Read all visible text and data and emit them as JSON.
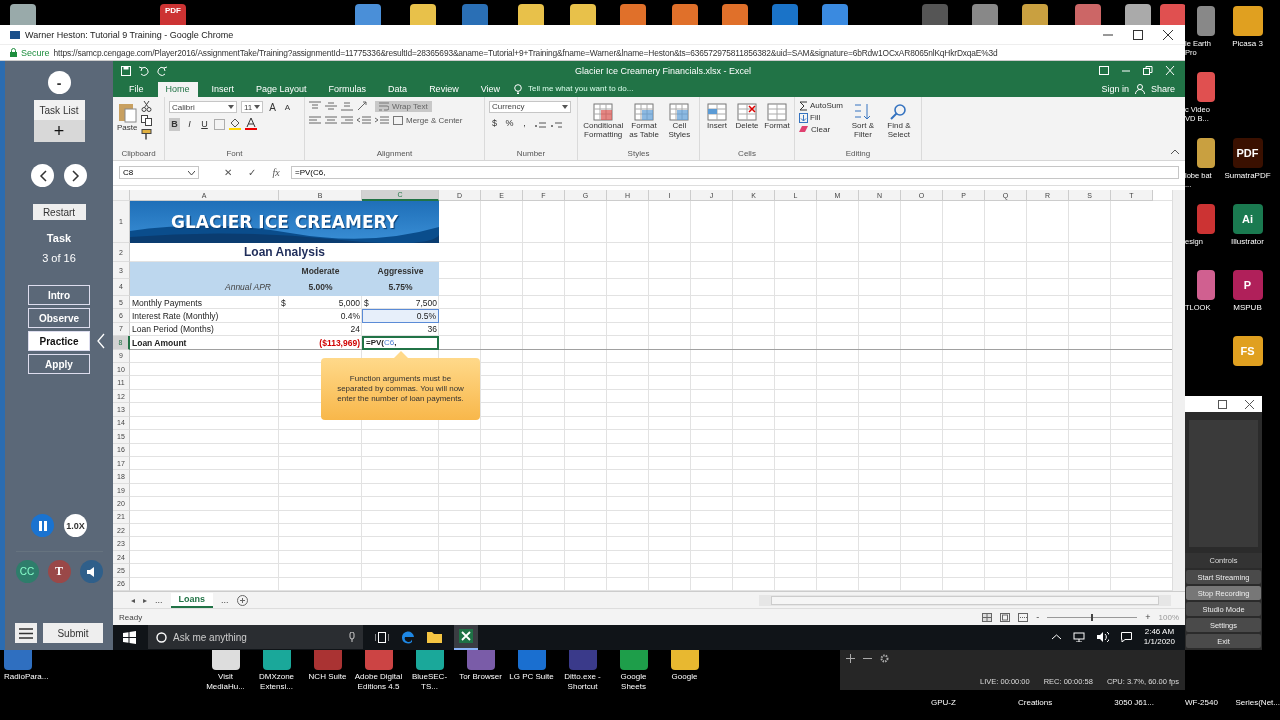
{
  "top_strip": {
    "pdf_badge": "PDF"
  },
  "browser": {
    "title": "Warner Heston: Tutorial 9 Training - Google Chrome",
    "secure": "Secure",
    "url": "https://samcp.cengage.com/Player2016/AssignmentTake/Training?assignmentId=11775336&resultId=28365693&aname=Tutorial+9+Training&fname=Warner&lname=Heston&ts=636572975811856382&uid=SAM&signature=6bRdw1OCxAR8065nlKqHkrDxqaE%3d"
  },
  "sam_panel": {
    "collapse": "-",
    "task_list": "Task List",
    "add": "+",
    "restart": "Restart",
    "task_label": "Task",
    "task_count": "3 of 16",
    "modes": [
      {
        "label": "Intro",
        "selected": false
      },
      {
        "label": "Observe",
        "selected": false
      },
      {
        "label": "Practice",
        "selected": true
      },
      {
        "label": "Apply",
        "selected": false
      }
    ],
    "speed": "1.0X",
    "captions": "CC",
    "transcript": "T",
    "submit": "Submit"
  },
  "excel": {
    "title": "Glacier Ice Creamery Financials.xlsx - Excel",
    "tabs": [
      {
        "label": "File",
        "selected": false
      },
      {
        "label": "Home",
        "selected": true
      },
      {
        "label": "Insert",
        "selected": false
      },
      {
        "label": "Page Layout",
        "selected": false
      },
      {
        "label": "Formulas",
        "selected": false
      },
      {
        "label": "Data",
        "selected": false
      },
      {
        "label": "Review",
        "selected": false
      },
      {
        "label": "View",
        "selected": false
      }
    ],
    "tell_me": "Tell me what you want to do...",
    "sign_in": "Sign in",
    "share": "Share",
    "clipboard": {
      "label": "Clipboard",
      "paste": "Paste"
    },
    "font": {
      "label": "Font",
      "family": "Calibri",
      "size": "11",
      "grow": "A",
      "shrink": "A",
      "styles": [
        {
          "label": "B",
          "selected": true
        },
        {
          "label": "I",
          "selected": false
        },
        {
          "label": "U",
          "selected": false
        }
      ]
    },
    "alignment": {
      "label": "Alignment",
      "wrap": "Wrap Text",
      "merge": "Merge & Center"
    },
    "number": {
      "label": "Number",
      "format": "Currency",
      "symbols": [
        "$",
        "%",
        ","
      ]
    },
    "styles": {
      "label": "Styles",
      "buttons": [
        "Conditional Formatting",
        "Format as Table",
        "Cell Styles"
      ]
    },
    "cells": {
      "label": "Cells",
      "buttons": [
        "Insert",
        "Delete",
        "Format"
      ]
    },
    "editing": {
      "label": "Editing",
      "autosum": "AutoSum",
      "fill": "Fill",
      "clear": "Clear",
      "buttons": [
        "Sort & Filter",
        "Find & Select"
      ]
    },
    "name_box": "C8",
    "cancel": "✕",
    "enter": "✓",
    "fx": "fx",
    "formula": "=PV(C6,",
    "columns": [
      {
        "label": "A",
        "selected": false
      },
      {
        "label": "B",
        "selected": false
      },
      {
        "label": "C",
        "selected": true
      },
      {
        "label": "D",
        "selected": false
      },
      {
        "label": "E",
        "selected": false
      },
      {
        "label": "F",
        "selected": false
      },
      {
        "label": "G",
        "selected": false
      },
      {
        "label": "H",
        "selected": false
      },
      {
        "label": "I",
        "selected": false
      },
      {
        "label": "J",
        "selected": false
      },
      {
        "label": "K",
        "selected": false
      },
      {
        "label": "L",
        "selected": false
      },
      {
        "label": "M",
        "selected": false
      },
      {
        "label": "N",
        "selected": false
      },
      {
        "label": "O",
        "selected": false
      },
      {
        "label": "P",
        "selected": false
      },
      {
        "label": "Q",
        "selected": false
      },
      {
        "label": "R",
        "selected": false
      },
      {
        "label": "S",
        "selected": false
      },
      {
        "label": "T",
        "selected": false
      }
    ],
    "rows": [
      {
        "number": "1",
        "kind": "banner",
        "selected": false,
        "text": "GLACIER ICE CREAMERY"
      },
      {
        "number": "2",
        "kind": "title",
        "selected": false,
        "text": "Loan Analysis"
      },
      {
        "number": "3",
        "kind": "band",
        "selected": false,
        "b": {
          "text": "Moderate"
        },
        "c": {
          "text": "Aggressive"
        }
      },
      {
        "number": "4",
        "kind": "band",
        "selected": false,
        "caption": "Annual APR",
        "b": {
          "text": "5.00%"
        },
        "c": {
          "text": "5.75%"
        }
      },
      {
        "number": "5",
        "kind": "data",
        "selected": false,
        "a": {
          "text": "Monthly Payments"
        },
        "b": {
          "symbol": "$",
          "text": "5,000"
        },
        "c": {
          "symbol": "$",
          "text": "7,500"
        }
      },
      {
        "number": "6",
        "kind": "data",
        "selected": false,
        "a": {
          "text": "Interest Rate (Monthly)"
        },
        "b": {
          "text": "0.4%"
        },
        "c": {
          "text": "0.5%",
          "referenced": true
        }
      },
      {
        "number": "7",
        "kind": "data",
        "selected": false,
        "a": {
          "text": "Loan Period (Months)"
        },
        "b": {
          "text": "24"
        },
        "c": {
          "text": "36"
        }
      },
      {
        "number": "8",
        "kind": "total",
        "selected": true,
        "a": {
          "text": "Loan Amount"
        },
        "b": {
          "text": "($113,969)",
          "negative": true
        },
        "c": {
          "formula": "=PV(",
          "ref": "C6",
          "tail": ","
        }
      },
      {
        "number": "9",
        "kind": "empty",
        "selected": false
      },
      {
        "number": "10",
        "kind": "empty",
        "selected": false
      },
      {
        "number": "11",
        "kind": "empty",
        "selected": false
      },
      {
        "number": "12",
        "kind": "empty",
        "selected": false
      },
      {
        "number": "13",
        "kind": "empty",
        "selected": false
      },
      {
        "number": "14",
        "kind": "empty",
        "selected": false
      },
      {
        "number": "15",
        "kind": "empty",
        "selected": false
      },
      {
        "number": "16",
        "kind": "empty",
        "selected": false
      },
      {
        "number": "17",
        "kind": "empty",
        "selected": false
      },
      {
        "number": "18",
        "kind": "empty",
        "selected": false
      },
      {
        "number": "19",
        "kind": "empty",
        "selected": false
      },
      {
        "number": "20",
        "kind": "empty",
        "selected": false
      },
      {
        "number": "21",
        "kind": "empty",
        "selected": false
      },
      {
        "number": "22",
        "kind": "empty",
        "selected": false
      },
      {
        "number": "23",
        "kind": "empty",
        "selected": false
      },
      {
        "number": "24",
        "kind": "empty",
        "selected": false
      },
      {
        "number": "25",
        "kind": "empty",
        "selected": false
      },
      {
        "number": "26",
        "kind": "empty",
        "selected": false
      }
    ],
    "callout": "Function arguments must be separated by commas. You will now enter the number of loan payments.",
    "sheet_nav": [
      "◂",
      "▸"
    ],
    "more": "...",
    "sheets": [
      {
        "label": "Loans",
        "selected": true
      }
    ],
    "status": "Ready",
    "zoom": "100%",
    "zoom_slider": {
      "level": 0.5
    },
    "zoom_minus": "-",
    "zoom_plus": "+"
  },
  "taskbar": {
    "search": "Ask me anything",
    "time": "2:46 AM",
    "date": "1/1/2020"
  },
  "desktop_right": [
    {
      "left": {
        "label": "le Earth Pro"
      },
      "right": {
        "label": "Picasa 3"
      }
    },
    {
      "left": {
        "label": "c Video VD B..."
      }
    },
    {
      "left": {
        "label": "lobe bat ..."
      },
      "right": {
        "label": "SumatraPDF",
        "badge": "PDF"
      }
    },
    {
      "left": {
        "label": "esign"
      },
      "right": {
        "label": "Illustrator",
        "badge": "Ai"
      }
    },
    {
      "left": {
        "label": "TLOOK"
      },
      "right": {
        "label": "MSPUB",
        "badge": "P"
      }
    },
    {
      "right": {
        "badge": "FS"
      }
    }
  ],
  "obs": {
    "header": "Controls",
    "buttons": [
      {
        "label": "Start Streaming",
        "selected": false
      },
      {
        "label": "Stop Recording",
        "selected": true
      },
      {
        "label": "Studio Mode",
        "selected": false
      },
      {
        "label": "Settings",
        "selected": false
      },
      {
        "label": "Exit",
        "selected": false
      }
    ],
    "status": [
      "LIVE: 00:00:00",
      "REC: 00:00:58",
      "CPU: 3.7%, 60.00 fps"
    ]
  },
  "desktop_bottom": [
    "RadioPara...",
    "Visit MediaHu...",
    "DMXzone Extensi...",
    "NCH Suite",
    "Adobe Digital Editions 4.5",
    "BlueSEC-TS...",
    "Tor Browser",
    "LG PC Suite",
    "Ditto.exe - Shortcut",
    "Google Sheets",
    "Google"
  ],
  "desktop_bottom_right": [
    "GPU-Z",
    "Creations",
    "3050 J61...",
    "WF-2540",
    "Series(Net..."
  ]
}
